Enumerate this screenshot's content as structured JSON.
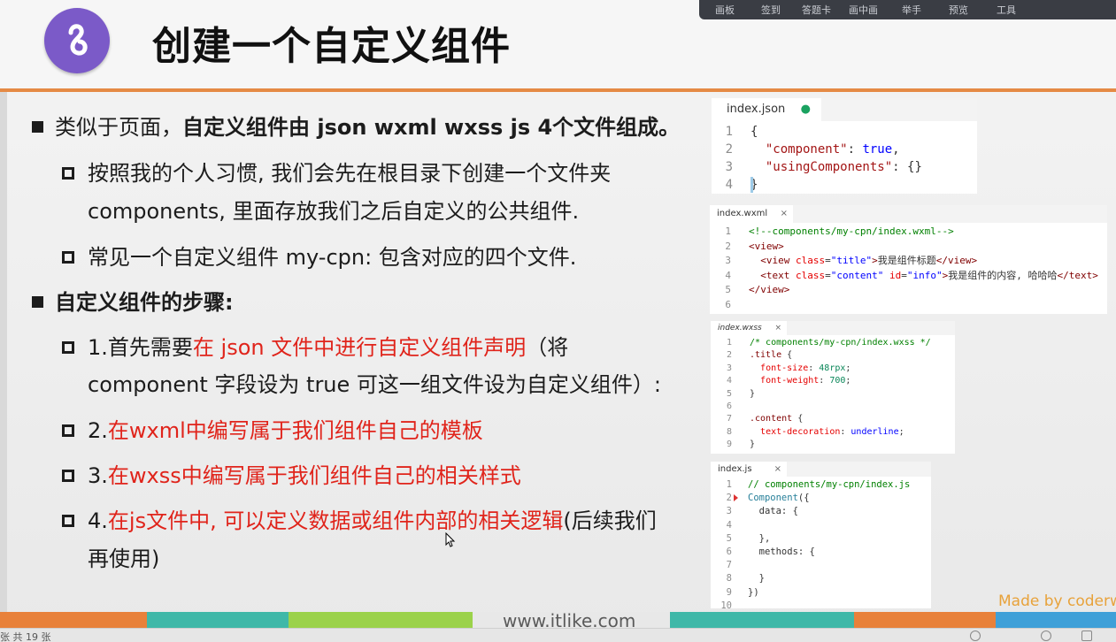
{
  "slide": {
    "title": "创建一个自定义组件",
    "bullets": [
      {
        "level": 1,
        "segments": [
          {
            "t": "类似于页面，",
            "s": "n"
          },
          {
            "t": "自定义组件由 json wxml wxss js 4个文件组成。",
            "s": "b"
          }
        ]
      },
      {
        "level": 2,
        "segments": [
          {
            "t": "按照我的个人习惯, 我们会先在根目录下创建一个文件夹",
            "s": "n"
          }
        ]
      },
      {
        "level": 0,
        "segments": [
          {
            "t": "components, 里面存放我们之后自定义的公共组件.",
            "s": "n"
          }
        ]
      },
      {
        "level": 2,
        "segments": [
          {
            "t": "常见一个自定义组件 my-cpn: 包含对应的四个文件.",
            "s": "n"
          }
        ]
      },
      {
        "level": 1,
        "segments": [
          {
            "t": "自定义组件的步骤:",
            "s": "b"
          }
        ]
      },
      {
        "level": 2,
        "segments": [
          {
            "t": "1.首先需要",
            "s": "n"
          },
          {
            "t": "在 json 文件中进行自定义组件声明",
            "s": "r"
          },
          {
            "t": "（将",
            "s": "n"
          }
        ]
      },
      {
        "level": 0,
        "segments": [
          {
            "t": "component 字段设为 true 可这一组文件设为自定义组件）:",
            "s": "n"
          }
        ]
      },
      {
        "level": 2,
        "segments": [
          {
            "t": "2.",
            "s": "n"
          },
          {
            "t": "在wxml中编写属于我们组件自己的模板",
            "s": "r"
          }
        ]
      },
      {
        "level": 2,
        "segments": [
          {
            "t": "3.",
            "s": "n"
          },
          {
            "t": "在wxss中编写属于我们组件自己的相关样式",
            "s": "r"
          }
        ]
      },
      {
        "level": 2,
        "segments": [
          {
            "t": "4.",
            "s": "n"
          },
          {
            "t": "在js文件中, 可以定义数据或组件内部的相关逻辑",
            "s": "r"
          },
          {
            "t": "(后续我们",
            "s": "n"
          }
        ]
      },
      {
        "level": 0,
        "segments": [
          {
            "t": "再使用)",
            "s": "n"
          }
        ]
      }
    ]
  },
  "toolbar": {
    "items": [
      "画板",
      "签到",
      "答题卡",
      "画中画",
      "举手",
      "预览",
      "工具"
    ]
  },
  "code_panels": [
    {
      "tab": "index.json",
      "tab_marker": "●",
      "lines": [
        {
          "n": "1",
          "parts": [
            [
              "p",
              "{"
            ]
          ]
        },
        {
          "n": "2",
          "parts": [
            [
              "p",
              "  "
            ],
            [
              "jkey",
              "\"component\""
            ],
            [
              "p",
              ": "
            ],
            [
              "bool",
              "true"
            ],
            [
              "p",
              ","
            ]
          ]
        },
        {
          "n": "3",
          "parts": [
            [
              "p",
              "  "
            ],
            [
              "jkey",
              "\"usingComponents\""
            ],
            [
              "p",
              ": {}"
            ]
          ]
        },
        {
          "n": "4",
          "parts": [
            [
              "p",
              "}"
            ]
          ]
        }
      ]
    },
    {
      "tab": "index.wxml",
      "tab_marker": "×",
      "lines": [
        {
          "n": "1",
          "parts": [
            [
              "cmt",
              "<!--components/my-cpn/index.wxml-->"
            ]
          ]
        },
        {
          "n": "2",
          "parts": [
            [
              "tag",
              "<view>"
            ]
          ]
        },
        {
          "n": "3",
          "parts": [
            [
              "p",
              "  "
            ],
            [
              "tag",
              "<view "
            ],
            [
              "attr",
              "class"
            ],
            [
              "p",
              "="
            ],
            [
              "str",
              "\"title\""
            ],
            [
              "tag",
              ">"
            ],
            [
              "p",
              "我是组件标题"
            ],
            [
              "tag",
              "</view>"
            ]
          ]
        },
        {
          "n": "4",
          "parts": [
            [
              "p",
              "  "
            ],
            [
              "tag",
              "<text "
            ],
            [
              "attr",
              "class"
            ],
            [
              "p",
              "="
            ],
            [
              "str",
              "\"content\""
            ],
            [
              "p",
              " "
            ],
            [
              "attr",
              "id"
            ],
            [
              "p",
              "="
            ],
            [
              "str",
              "\"info\""
            ],
            [
              "tag",
              ">"
            ],
            [
              "p",
              "我是组件的内容, 哈哈哈"
            ],
            [
              "tag",
              "</text>"
            ]
          ]
        },
        {
          "n": "5",
          "parts": [
            [
              "tag",
              "</view>"
            ]
          ]
        },
        {
          "n": "6",
          "parts": [
            [
              "p",
              ""
            ]
          ]
        }
      ]
    },
    {
      "tab": "index.wxss",
      "tab_marker": "×",
      "lines": [
        {
          "n": "1",
          "parts": [
            [
              "cmt",
              "/* components/my-cpn/index.wxss */"
            ]
          ]
        },
        {
          "n": "2",
          "parts": [
            [
              "sel",
              ".title"
            ],
            [
              "p",
              " {"
            ]
          ]
        },
        {
          "n": "3",
          "parts": [
            [
              "p",
              "  "
            ],
            [
              "prop",
              "font-size"
            ],
            [
              "p",
              ": "
            ],
            [
              "num",
              "48rpx"
            ],
            [
              "p",
              ";"
            ]
          ]
        },
        {
          "n": "4",
          "parts": [
            [
              "p",
              "  "
            ],
            [
              "prop",
              "font-weight"
            ],
            [
              "p",
              ": "
            ],
            [
              "num",
              "700"
            ],
            [
              "p",
              ";"
            ]
          ]
        },
        {
          "n": "5",
          "parts": [
            [
              "p",
              "}"
            ]
          ]
        },
        {
          "n": "6",
          "parts": [
            [
              "p",
              ""
            ]
          ]
        },
        {
          "n": "7",
          "parts": [
            [
              "sel",
              ".content"
            ],
            [
              "p",
              " {"
            ]
          ]
        },
        {
          "n": "8",
          "parts": [
            [
              "p",
              "  "
            ],
            [
              "prop",
              "text-decoration"
            ],
            [
              "p",
              ": "
            ],
            [
              "str",
              "underline"
            ],
            [
              "p",
              ";"
            ]
          ]
        },
        {
          "n": "9",
          "parts": [
            [
              "p",
              "}"
            ]
          ]
        }
      ]
    },
    {
      "tab": "index.js",
      "tab_marker": "×",
      "lines": [
        {
          "n": "1",
          "parts": [
            [
              "cmt",
              "// components/my-cpn/index.js"
            ]
          ]
        },
        {
          "n": "2",
          "parts": [
            [
              "fn",
              "Component"
            ],
            [
              "p",
              "({"
            ]
          ]
        },
        {
          "n": "3",
          "parts": [
            [
              "p",
              "  data: {"
            ]
          ]
        },
        {
          "n": "4",
          "parts": [
            [
              "p",
              ""
            ]
          ]
        },
        {
          "n": "5",
          "parts": [
            [
              "p",
              "  },"
            ]
          ]
        },
        {
          "n": "6",
          "parts": [
            [
              "p",
              "  methods: {"
            ]
          ]
        },
        {
          "n": "7",
          "parts": [
            [
              "p",
              ""
            ]
          ]
        },
        {
          "n": "8",
          "parts": [
            [
              "p",
              "  }"
            ]
          ]
        },
        {
          "n": "9",
          "parts": [
            [
              "p",
              "})"
            ]
          ]
        },
        {
          "n": "10",
          "parts": [
            [
              "p",
              ""
            ]
          ]
        }
      ]
    }
  ],
  "footer": {
    "website": "www.itlike.com",
    "made_by": "Made by coderw"
  },
  "statusbar": {
    "text": "张  共 19 张"
  },
  "colors": {
    "accent": "#e58a45",
    "logo": "#7b5ac8",
    "highlight": "#e0241b",
    "strip": [
      "#e8813a",
      "#3fb8a8",
      "#9bd24a",
      "#e8e8e8",
      "#3fb8a8",
      "#e8813a",
      "#3fa0d8"
    ]
  }
}
